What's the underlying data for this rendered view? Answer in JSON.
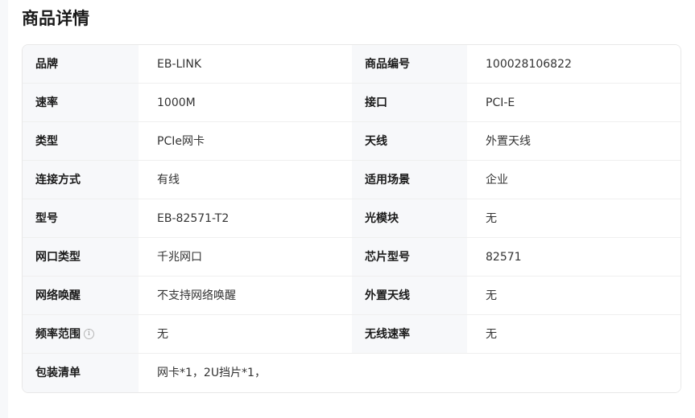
{
  "section": {
    "title": "商品详情"
  },
  "specs": {
    "rows": [
      {
        "label1": "品牌",
        "value1": "EB-LINK",
        "label2": "商品编号",
        "value2": "100028106822"
      },
      {
        "label1": "速率",
        "value1": "1000M",
        "label2": "接口",
        "value2": "PCI-E"
      },
      {
        "label1": "类型",
        "value1": "PCIe网卡",
        "label2": "天线",
        "value2": "外置天线"
      },
      {
        "label1": "连接方式",
        "value1": "有线",
        "label2": "适用场景",
        "value2": "企业"
      },
      {
        "label1": "型号",
        "value1": "EB-82571-T2",
        "label2": "光模块",
        "value2": "无"
      },
      {
        "label1": "网口类型",
        "value1": "千兆网口",
        "label2": "芯片型号",
        "value2": "82571"
      },
      {
        "label1": "网络唤醒",
        "value1": "不支持网络唤醒",
        "label2": "外置天线",
        "value2": "无"
      },
      {
        "label1": "频率范围",
        "value1": "无",
        "label2": "无线速率",
        "value2": "无"
      }
    ],
    "package": {
      "label": "包装清单",
      "value": "网卡*1，2U挡片*1，"
    }
  },
  "icons": {
    "info": "info-circle-icon",
    "info_glyph": "i"
  },
  "colors": {
    "label_bg": "#f7f8fa",
    "value_bg": "#ffffff",
    "border": "#e8e8e8",
    "page_bg": "#f7f8fa"
  }
}
